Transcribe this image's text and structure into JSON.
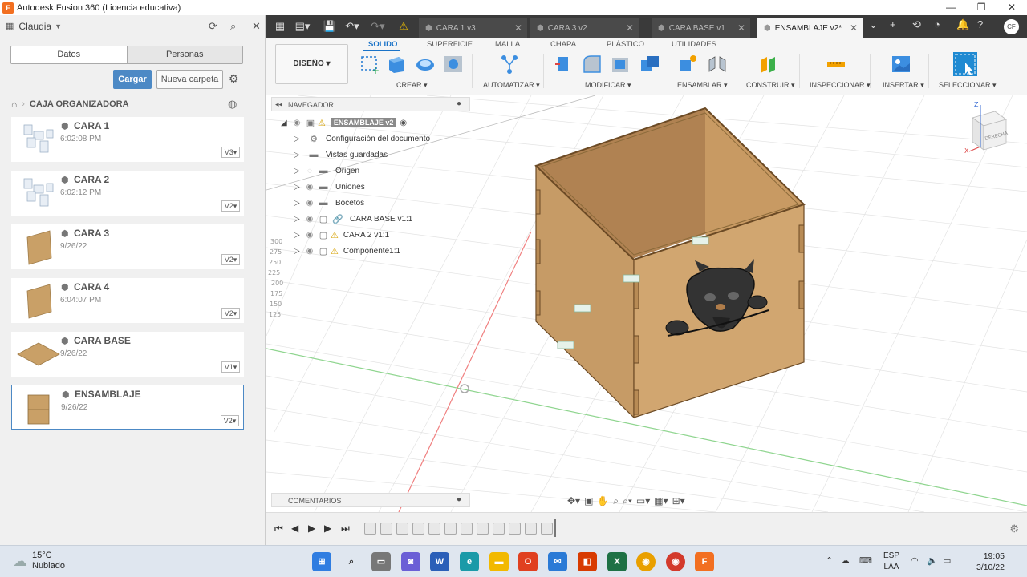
{
  "window": {
    "title": "Autodesk Fusion 360 (Licencia educativa)",
    "app_icon": "F"
  },
  "left_panel": {
    "user": "Claudia",
    "tabs": [
      "Datos",
      "Personas"
    ],
    "upload_label": "Cargar",
    "new_folder_label": "Nueva carpeta",
    "breadcrumb": "CAJA ORGANIZADORA",
    "files": [
      {
        "name": "CARA 1",
        "date": "6:02:08 PM",
        "version": "V3"
      },
      {
        "name": "CARA 2",
        "date": "6:02:12 PM",
        "version": "V2"
      },
      {
        "name": "CARA 3",
        "date": "9/26/22",
        "version": "V2"
      },
      {
        "name": "CARA 4",
        "date": "6:04:07 PM",
        "version": "V2"
      },
      {
        "name": "CARA BASE",
        "date": "9/26/22",
        "version": "V1"
      },
      {
        "name": "ENSAMBLAJE",
        "date": "9/26/22",
        "version": "V2"
      }
    ]
  },
  "doc_tabs": [
    {
      "label": "CARA 1 v3"
    },
    {
      "label": "CARA 3 v2"
    },
    {
      "label": "CARA BASE v1"
    },
    {
      "label": "ENSAMBLAJE v2*"
    }
  ],
  "toolbar": {
    "workspace": "DISEÑO",
    "tabs": [
      "SOLIDO",
      "SUPERFICIE",
      "MALLA",
      "CHAPA",
      "PLÁSTICO",
      "UTILIDADES"
    ],
    "groups": [
      "CREAR",
      "AUTOMATIZAR",
      "MODIFICAR",
      "ENSAMBLAR",
      "CONSTRUIR",
      "INSPECCIONAR",
      "INSERTAR",
      "SELECCIONAR"
    ]
  },
  "browser": {
    "title": "NAVEGADOR",
    "root": "ENSAMBLAJE v2",
    "items": [
      {
        "label": "Configuración del documento"
      },
      {
        "label": "Vistas guardadas"
      },
      {
        "label": "Origen"
      },
      {
        "label": "Uniones"
      },
      {
        "label": "Bocetos"
      },
      {
        "label": "CARA BASE v1:1"
      },
      {
        "label": "CARA 2 v1:1"
      },
      {
        "label": "Componente1:1"
      }
    ]
  },
  "comments": {
    "title": "COMENTARIOS"
  },
  "viewcube": {
    "face": "DERECHA",
    "axis_z": "Z",
    "axis_x": "X"
  },
  "ruler_labels": [
    "300",
    "275",
    "250",
    "225",
    "200",
    "175",
    "150",
    "125"
  ],
  "taskbar": {
    "temp": "15°C",
    "weather": "Nublado",
    "lang1": "ESP",
    "lang2": "LAA",
    "time": "19:05",
    "date": "3/10/22"
  },
  "colors": {
    "accent": "#4c89c5",
    "wood": "#c9a067",
    "dark_tab": "#3a3a3a"
  }
}
